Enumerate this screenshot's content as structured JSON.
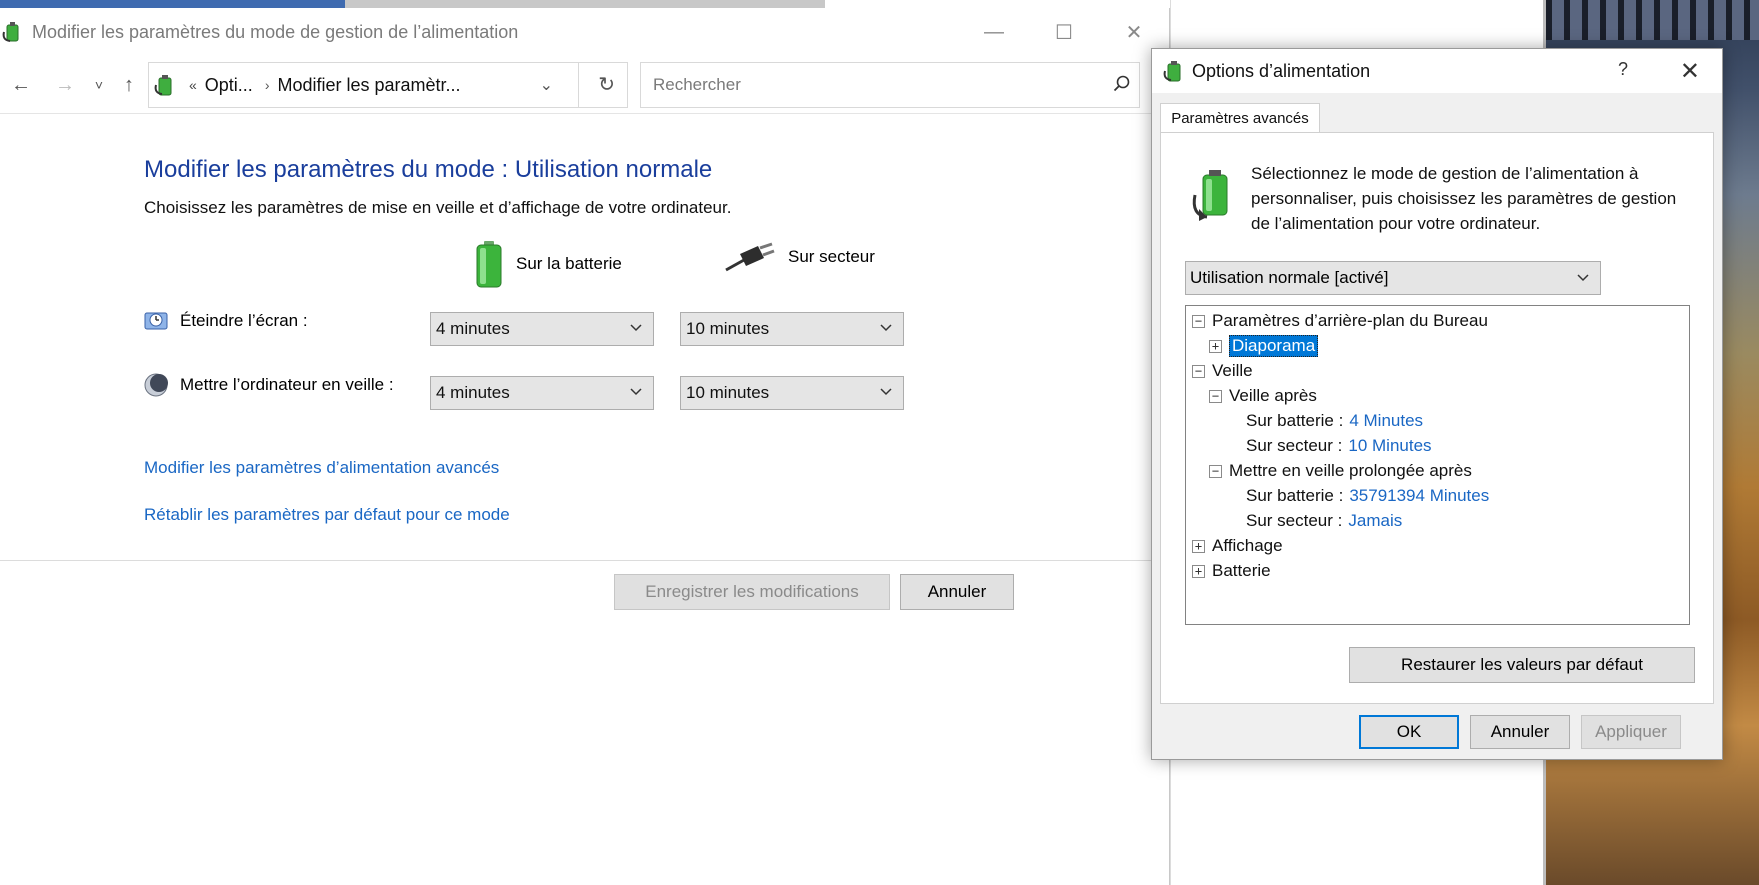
{
  "main_window": {
    "title": "Modifier les paramètres du mode de gestion de l’alimentation",
    "controls": {
      "minimize": "—",
      "maximize": "☐",
      "close": "✕"
    },
    "nav": {
      "back": "←",
      "forward": "→",
      "recent": "˅",
      "up": "↑",
      "breadcrumb_chevron": "«",
      "crumb_1": "Opti...",
      "crumb_sep": "›",
      "crumb_2": "Modifier les paramètr...",
      "address_dropdown": "⌄",
      "refresh": "↻",
      "search_placeholder": "Rechercher"
    },
    "page": {
      "title": "Modifier les paramètres du mode : Utilisation normale",
      "subtitle": "Choisissez les paramètres de mise en veille et d’affichage de votre ordinateur.",
      "battery_header": "Sur la batterie",
      "ac_header": "Sur secteur",
      "rows": [
        {
          "label": "Éteindre l’écran :",
          "battery": "4 minutes",
          "ac": "10 minutes",
          "icon": "display-timer-icon"
        },
        {
          "label": "Mettre l’ordinateur en veille :",
          "battery": "4 minutes",
          "ac": "10 minutes",
          "icon": "sleep-moon-icon"
        }
      ],
      "link_advanced": "Modifier les paramètres d’alimentation avancés",
      "link_restore": "Rétablir les paramètres par défaut pour ce mode",
      "save_button": "Enregistrer les modifications",
      "cancel_button": "Annuler"
    }
  },
  "dialog": {
    "title": "Options d’alimentation",
    "help": "?",
    "close": "✕",
    "tab": "Paramètres avancés",
    "intro": "Sélectionnez le mode de gestion de l’alimentation à personnaliser, puis choisissez les paramètres de gestion de l’alimentation pour votre ordinateur.",
    "plan": "Utilisation normale [activé]",
    "tree": {
      "desktop_bg": "Paramètres d’arrière-plan du Bureau",
      "slideshow": "Diaporama",
      "sleep": "Veille",
      "sleep_after": "Veille après",
      "sleep_after_battery_label": "Sur batterie :",
      "sleep_after_battery_value": "4 Minutes",
      "sleep_after_ac_label": "Sur secteur :",
      "sleep_after_ac_value": "10 Minutes",
      "hibernate_after": "Mettre en veille prolongée après",
      "hibernate_battery_label": "Sur batterie :",
      "hibernate_battery_value": "35791394 Minutes",
      "hibernate_ac_label": "Sur secteur :",
      "hibernate_ac_value": "Jamais",
      "display": "Affichage",
      "battery": "Batterie",
      "expanded_glyph": "−",
      "collapsed_glyph": "+"
    },
    "restore_button": "Restaurer les valeurs par défaut",
    "ok_button": "OK",
    "cancel_button": "Annuler",
    "apply_button": "Appliquer"
  },
  "colors": {
    "title_blue": "#1a3e9c",
    "link_blue": "#1a67c4",
    "selection": "#0078d7"
  }
}
